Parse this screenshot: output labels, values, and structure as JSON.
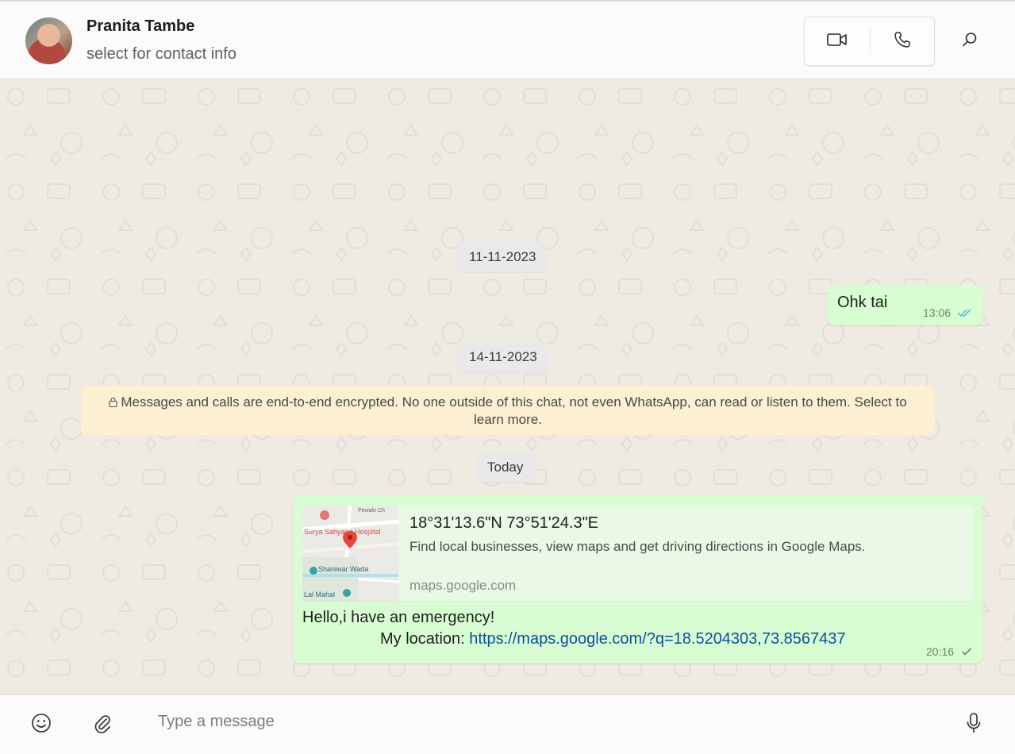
{
  "header": {
    "contact_name": "Pranita Tambe",
    "contact_subtitle": "select for contact info",
    "actions": [
      "video-call-icon",
      "phone-call-icon",
      "search-icon"
    ]
  },
  "chat": {
    "date_1": "11-11-2023",
    "message_1": {
      "text": "Ohk tai",
      "time": "13:06",
      "status": "read"
    },
    "date_2": "14-11-2023",
    "encryption_notice": "Messages and calls are end-to-end encrypted. No one outside of this chat, not even WhatsApp, can read or listen to them. Select to learn more.",
    "date_3": "Today",
    "message_2": {
      "link_preview": {
        "title": "18°31'13.6\"N 73°51'24.3\"E",
        "description": "Find local businesses, view maps and get driving directions in Google Maps.",
        "domain": "maps.google.com",
        "map_labels": {
          "place_1": "Surya Sahyadri Hospital",
          "place_2": "Shaniwar Wada",
          "place_3": "Lal Mahal",
          "top_label": "Pewale Ch"
        }
      },
      "line_1": "Hello,i have an emergency!",
      "line_2_prefix": "My location: ",
      "link": "https://maps.google.com/?q=18.5204303,73.8567437",
      "time": "20:16",
      "status": "sent"
    }
  },
  "footer": {
    "placeholder": "Type a message",
    "icons": [
      "emoji-icon",
      "attach-icon",
      "microphone-icon"
    ]
  },
  "colors": {
    "outgoing_bubble": "#d9fdd3",
    "chat_background": "#efeae2",
    "notice_background": "#fdf0d2",
    "read_tick": "#53bdeb",
    "link": "#0b4f9c"
  }
}
